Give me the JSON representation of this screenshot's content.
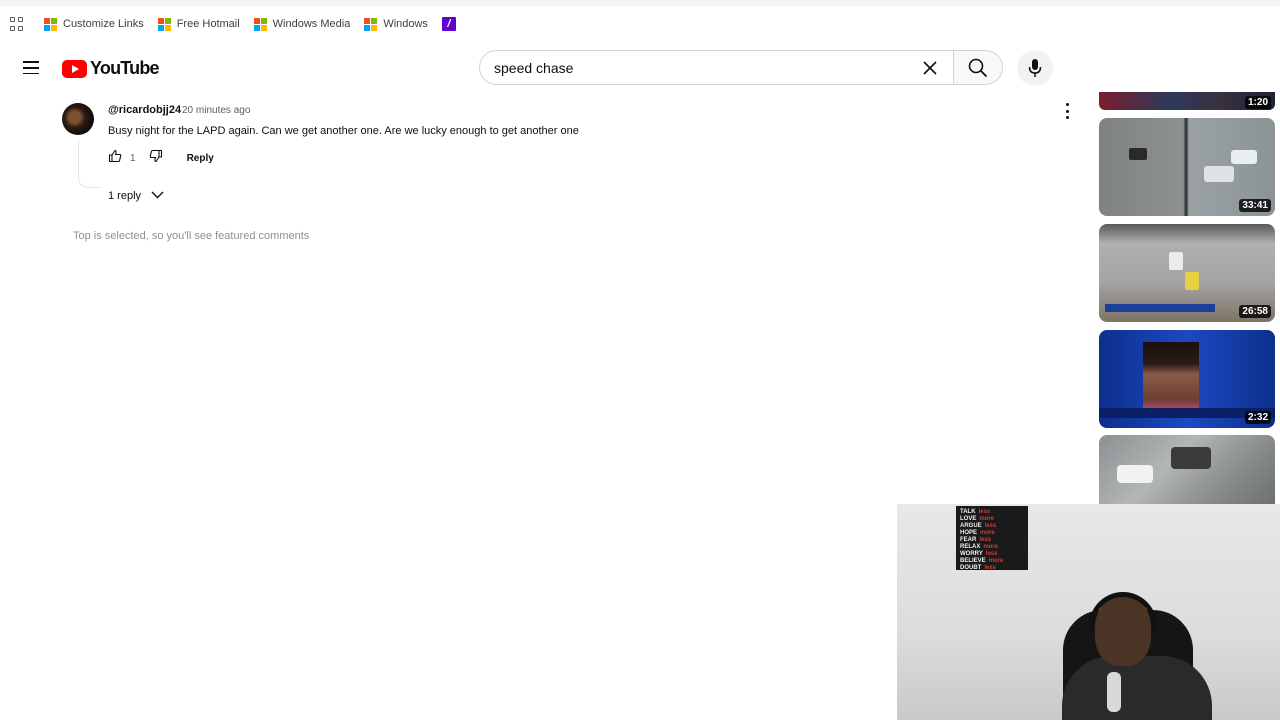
{
  "bookmarks": {
    "items": [
      {
        "label": "Customize Links",
        "icon": "microsoft-logo-icon"
      },
      {
        "label": "Free Hotmail",
        "icon": "microsoft-logo-icon"
      },
      {
        "label": "Windows Media",
        "icon": "microsoft-logo-icon"
      },
      {
        "label": "Windows",
        "icon": "microsoft-logo-icon"
      }
    ],
    "yahoo_icon": "yahoo-icon"
  },
  "header": {
    "logo_text": "YouTube",
    "search_value": "speed chase"
  },
  "comment": {
    "author": "@ricardobjj24",
    "time": "20 minutes ago",
    "text": "Busy night for the LAPD again. Can we get another one. Are we lucky enough to get another one",
    "likes": "1",
    "reply_label": "Reply",
    "replies_label": "1 reply"
  },
  "featured_note": "Top is selected, so you'll see featured comments",
  "thumbnails": [
    {
      "duration": "1:20"
    },
    {
      "duration": "33:41"
    },
    {
      "duration": "26:58"
    },
    {
      "duration": "2:32"
    },
    {
      "duration": ""
    }
  ],
  "webcam": {
    "poster": [
      [
        "TALK",
        "less"
      ],
      [
        "LOVE",
        "more"
      ],
      [
        "ARGUE",
        "less"
      ],
      [
        "HOPE",
        "more"
      ],
      [
        "FEAR",
        "less"
      ],
      [
        "RELAX",
        "more"
      ],
      [
        "WORRY",
        "less"
      ],
      [
        "BELIEVE",
        "more"
      ],
      [
        "DOUBT",
        "less"
      ]
    ]
  },
  "colors": {
    "youtube_red": "#ff0000",
    "microsoft_red": "#f25022",
    "microsoft_green": "#7fba00",
    "microsoft_blue": "#00a4ef",
    "microsoft_yellow": "#ffb900",
    "yahoo_purple": "#6001d2"
  }
}
